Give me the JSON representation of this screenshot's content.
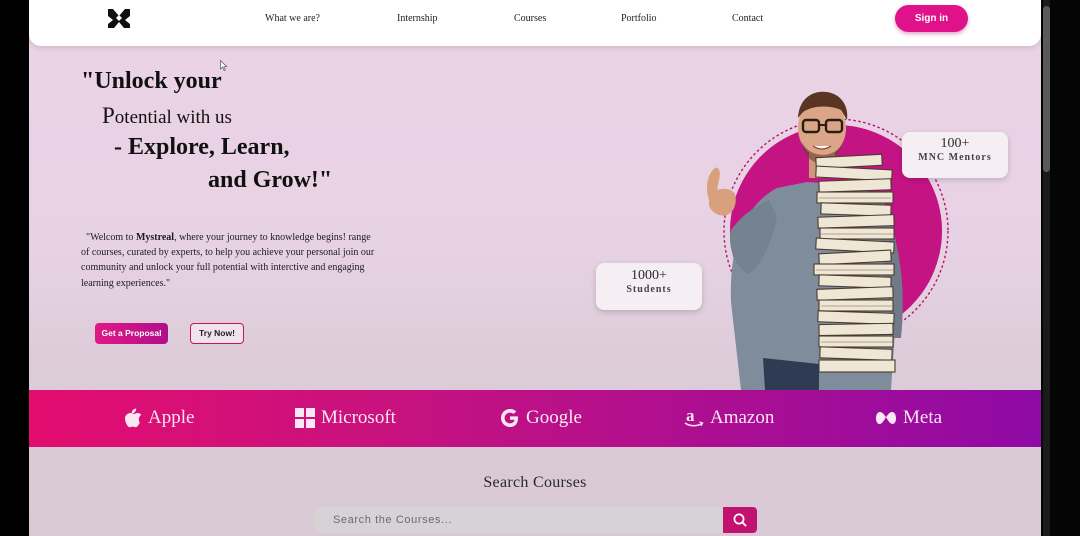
{
  "nav": {
    "links": [
      "What we are?",
      "Internship",
      "Courses",
      "Portfolio",
      "Contact"
    ],
    "signin": "Sign in"
  },
  "hero": {
    "line1": "\"Unlock your",
    "line2_cap": "P",
    "line2_rest": "otential with us",
    "line3": "- Explore, Learn,",
    "line4": "and Grow!\"",
    "intro_pre": "\"Welcom to ",
    "intro_brand": "Mystreal",
    "intro_post": ", where your journey to knowledge begins! range of courses, curated by experts, to help you achieve your personal join our community and unlock your full potential with interctive and engaging learning experiences.\"",
    "btn_proposal": "Get a Proposal",
    "btn_try": "Try Now!"
  },
  "stats": [
    {
      "number": "100+",
      "label": "MNC Mentors"
    },
    {
      "number": "1000+",
      "label": "Students"
    }
  ],
  "brands": [
    {
      "name": "Apple",
      "icon": "apple-icon"
    },
    {
      "name": "Microsoft",
      "icon": "windows-icon"
    },
    {
      "name": "Google",
      "icon": "google-icon"
    },
    {
      "name": "Amazon",
      "icon": "amazon-icon"
    },
    {
      "name": "Meta",
      "icon": "meta-icon"
    }
  ],
  "search": {
    "title": "Search Courses",
    "placeholder": "Search the Courses..."
  },
  "colors": {
    "accent": "#e0128a",
    "band_start": "#e30d6f",
    "band_end": "#8f0aa5",
    "page_bg": "#ecd3e6"
  }
}
